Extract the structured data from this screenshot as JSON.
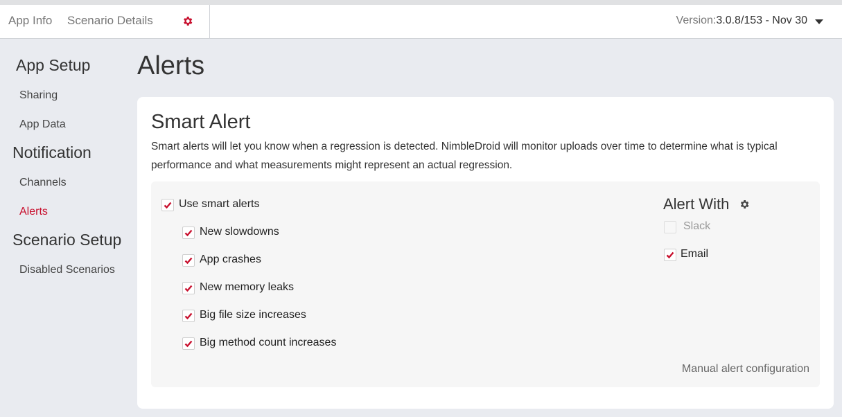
{
  "topbar": {
    "tabs": [
      "App Info",
      "Scenario Details"
    ],
    "version_label": "Version:",
    "version_value": "3.0.8/153 - Nov 30"
  },
  "sidebar": {
    "sections": [
      {
        "title": "App Setup",
        "items": [
          "Sharing",
          "App Data"
        ]
      },
      {
        "title": "Notification",
        "items": [
          "Channels",
          "Alerts"
        ]
      },
      {
        "title": "Scenario Setup",
        "items": [
          "Disabled Scenarios"
        ]
      }
    ],
    "active_item": "Alerts"
  },
  "page": {
    "title": "Alerts"
  },
  "smart_alert": {
    "title": "Smart Alert",
    "description": "Smart alerts will let you know when a regression is detected. NimbleDroid will monitor uploads over time to determine what is typical performance and what measurements might represent an actual regression.",
    "use_smart_alerts": {
      "label": "Use smart alerts",
      "checked": true
    },
    "options": [
      {
        "label": "New slowdowns",
        "checked": true
      },
      {
        "label": "App crashes",
        "checked": true
      },
      {
        "label": "New memory leaks",
        "checked": true
      },
      {
        "label": "Big file size increases",
        "checked": true
      },
      {
        "label": "Big method count increases",
        "checked": true
      }
    ],
    "alert_with": {
      "title": "Alert With",
      "channels": [
        {
          "label": "Slack",
          "checked": false,
          "disabled": true
        },
        {
          "label": "Email",
          "checked": true,
          "disabled": false
        }
      ]
    },
    "manual_link": "Manual alert configuration"
  },
  "colors": {
    "accent": "#c8102e",
    "background": "#e9ebf0",
    "card": "#ffffff",
    "panel": "#f6f6f6"
  }
}
